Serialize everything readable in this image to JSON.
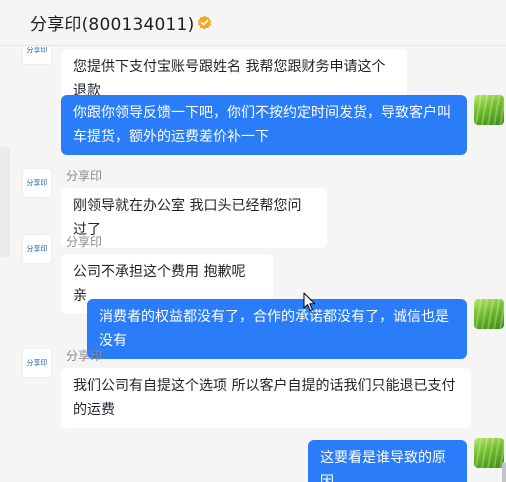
{
  "header": {
    "title": "分享印(800134011)",
    "verified_icon": "verified-badge-icon"
  },
  "shop": {
    "avatar_text": "分享印",
    "avatar_icon": "shop-logo-icon"
  },
  "messages": [
    {
      "from": "shop",
      "sender": "",
      "text": "您提供下支付宝账号跟姓名  我帮您跟财务申请这个退款"
    },
    {
      "from": "me",
      "text": "你跟你领导反馈一下吧，你们不按约定时间发货，导致客户叫车提货，额外的运费差价补一下"
    },
    {
      "from": "shop",
      "sender": "分享印",
      "text": "刚领导就在办公室  我口头已经帮您问过了"
    },
    {
      "from": "shop",
      "sender": "分享印",
      "text": "公司不承担这个费用  抱歉呢 亲"
    },
    {
      "from": "me",
      "text": "消费者的权益都没有了，合作的承诺都没有了，诚信也是没有"
    },
    {
      "from": "shop",
      "sender": "分享印",
      "text": "我们公司有自提这个选项  所以客户自提的话我们只能退已支付的运费"
    },
    {
      "from": "me",
      "text": "这要看是谁导致的原因"
    }
  ],
  "colors": {
    "outgoing_bubble": "#2a7cf8",
    "incoming_bubble": "#ffffff",
    "verified": "#f5a623"
  }
}
